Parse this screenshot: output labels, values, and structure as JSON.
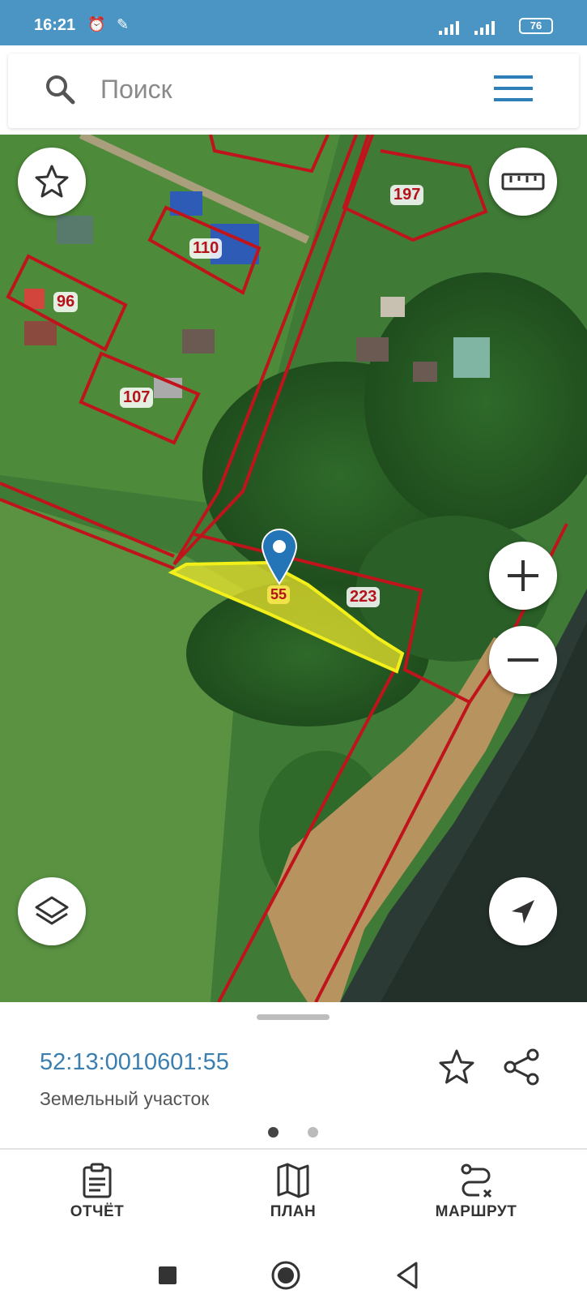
{
  "status_bar": {
    "time": "16:21",
    "battery": "76"
  },
  "search": {
    "placeholder": "Поиск"
  },
  "map": {
    "parcel_labels": [
      "197",
      "110",
      "96",
      "107",
      "223",
      "55"
    ],
    "selected_parcel_label": "55"
  },
  "parcel_card": {
    "cadastral_number": "52:13:0010601:55",
    "type": "Земельный участок"
  },
  "bottom_tabs": [
    {
      "label": "ОТЧЁТ",
      "icon": "clipboard-icon"
    },
    {
      "label": "ПЛАН",
      "icon": "map-icon"
    },
    {
      "label": "МАРШРУТ",
      "icon": "route-icon"
    }
  ],
  "colors": {
    "accent": "#3b7fb0",
    "status_bar": "#4b95c4",
    "parcel_border": "#c0141c",
    "selected_parcel": "#f2ef1a"
  }
}
